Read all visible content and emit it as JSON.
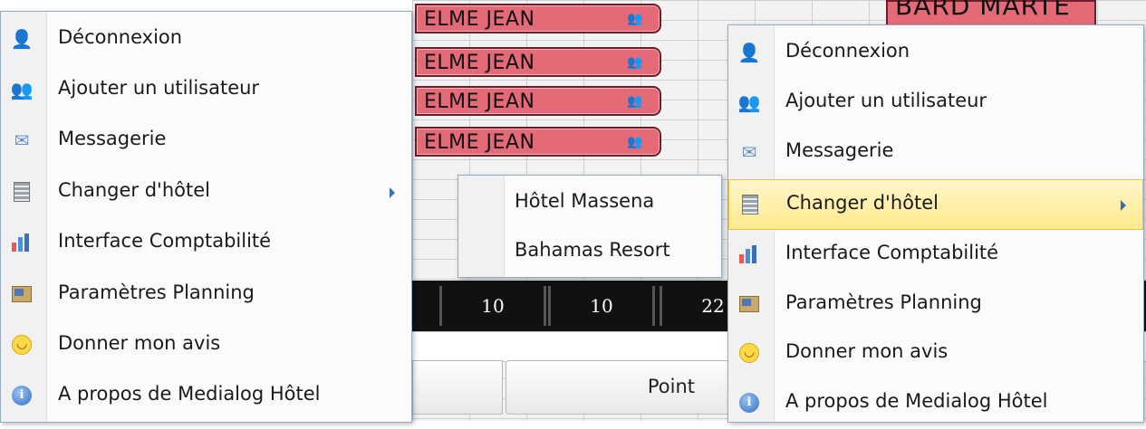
{
  "planning": {
    "booking_name": "ELME JEAN",
    "top_booking_name": "BARD MARTE",
    "counts": [
      "10",
      "10",
      "22"
    ],
    "point_button": "Point"
  },
  "menu_left": {
    "items": [
      {
        "label": "Déconnexion",
        "icon": "user-logout-icon"
      },
      {
        "label": "Ajouter un utilisateur",
        "icon": "add-users-icon"
      },
      {
        "label": "Messagerie",
        "icon": "envelope-icon"
      },
      {
        "label": "Changer d'hôtel",
        "icon": "hotel-building-icon"
      },
      {
        "label": "Interface Comptabilité",
        "icon": "bar-chart-icon"
      },
      {
        "label": "Paramètres Planning",
        "icon": "settings-icon"
      },
      {
        "label": "Donner mon avis",
        "icon": "smiley-icon"
      },
      {
        "label": "A propos de Medialog Hôtel",
        "icon": "info-icon"
      }
    ]
  },
  "submenu": {
    "items": [
      "Hôtel Massena",
      "Bahamas Resort"
    ]
  },
  "menu_right": {
    "highlighted_item": "Changer d'hôtel",
    "items": [
      {
        "label": "Déconnexion"
      },
      {
        "label": "Ajouter un utilisateur"
      },
      {
        "label": "Messagerie"
      },
      {
        "label": "Changer d'hôtel"
      },
      {
        "label": "Interface Comptabilité"
      },
      {
        "label": "Paramètres Planning"
      },
      {
        "label": "Donner mon avis"
      },
      {
        "label": "A propos de Medialog Hôtel"
      }
    ]
  },
  "colors": {
    "booking": "#e46a78",
    "highlight": "#ffe98c",
    "submenu_arrow": "#3d6db5"
  }
}
